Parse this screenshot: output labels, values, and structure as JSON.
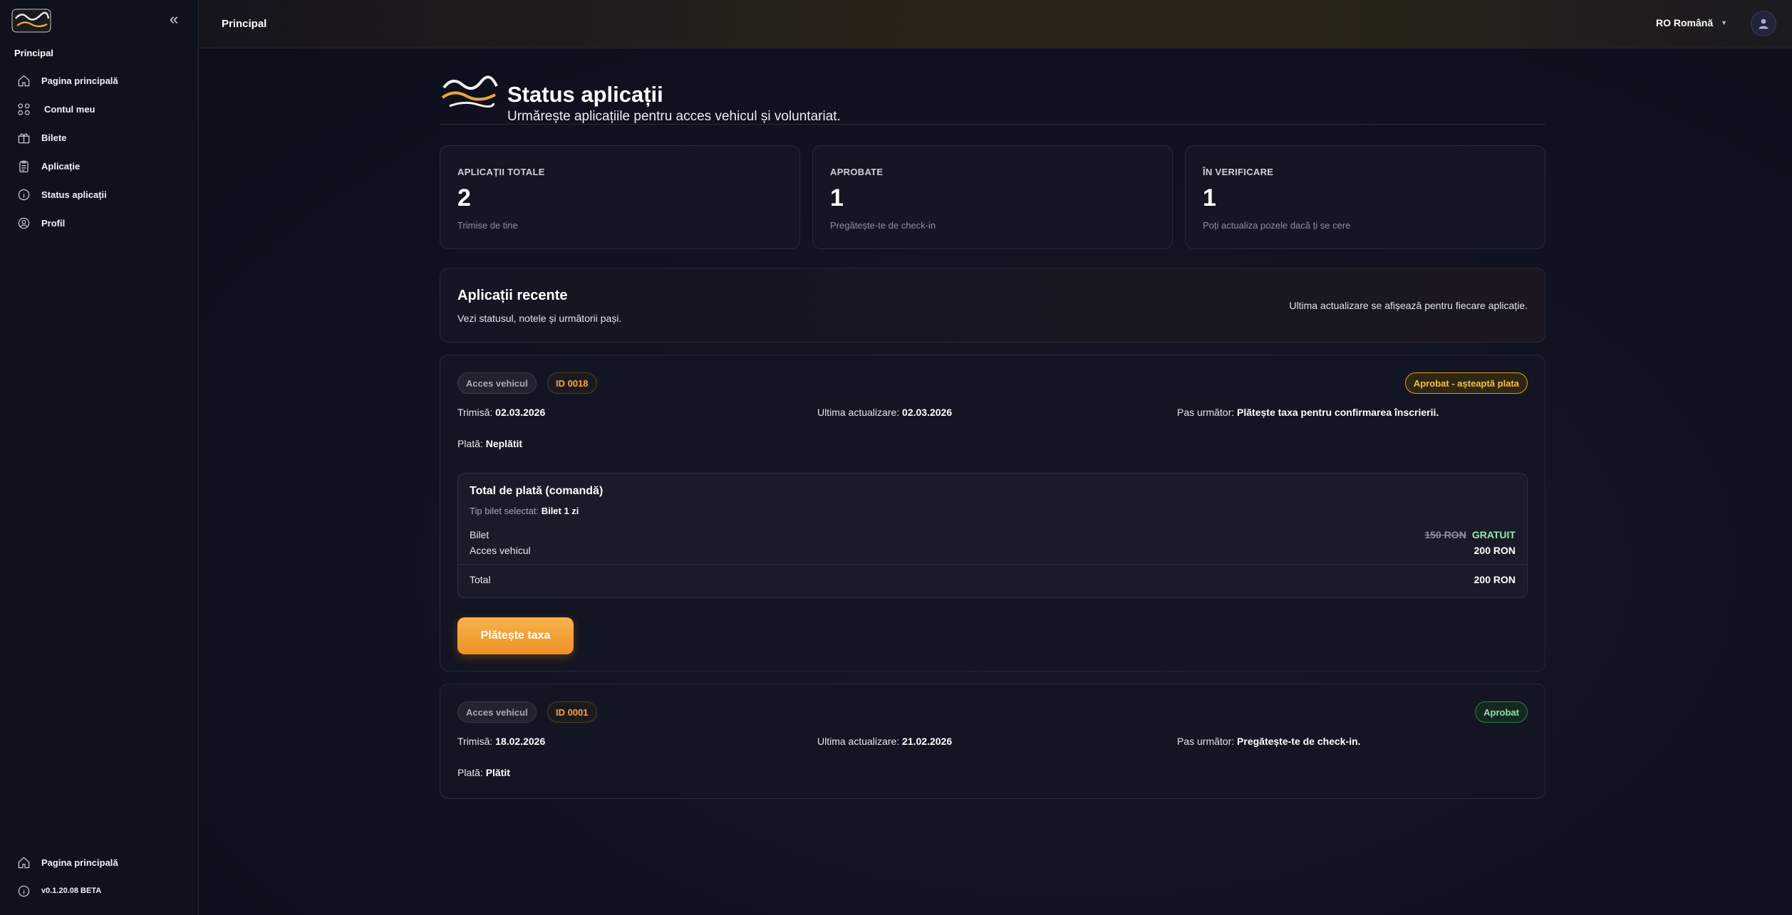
{
  "sidebar": {
    "section_label": "Principal",
    "items": [
      {
        "label": "Pagina principală",
        "icon": "home-icon"
      },
      {
        "label": "Contul meu",
        "icon": "grid-icon"
      },
      {
        "label": "Bilete",
        "icon": "gift-icon"
      },
      {
        "label": "Aplicație",
        "icon": "clipboard-icon"
      },
      {
        "label": "Status aplicații",
        "icon": "info-icon"
      },
      {
        "label": "Profil",
        "icon": "user-circle-icon"
      }
    ],
    "footer": {
      "home_label": "Pagina principală",
      "version": "v0.1.20.08 BETA"
    }
  },
  "header": {
    "title": "Principal",
    "language": "RO Română"
  },
  "page": {
    "title": "Status aplicații",
    "subtitle": "Urmărește aplicațiile pentru acces vehicul și voluntariat."
  },
  "stats": [
    {
      "label": "APLICAȚII TOTALE",
      "value": "2",
      "note": "Trimise de tine"
    },
    {
      "label": "APROBATE",
      "value": "1",
      "note": "Pregătește-te de check-in"
    },
    {
      "label": "ÎN VERIFICARE",
      "value": "1",
      "note": "Poți actualiza pozele dacă ți se cere"
    }
  ],
  "recent": {
    "title": "Aplicații recente",
    "subtitle": "Vezi statusul, notele și următorii pași.",
    "note": "Ultima actualizare se afișează pentru fiecare aplicație."
  },
  "applications": [
    {
      "type": "Acces vehicul",
      "id": "ID 0018",
      "status": "Aprobat - așteaptă plata",
      "submitted_label": "Trimisă:",
      "submitted": "02.03.2026",
      "updated_label": "Ultima actualizare:",
      "updated": "02.03.2026",
      "next_label": "Pas următor:",
      "next": "Plătește taxa pentru confirmarea înscrierii.",
      "payment_label": "Plată:",
      "payment": "Neplătit",
      "order": {
        "title": "Total de plată (comandă)",
        "ticket_label": "Tip bilet selectat:",
        "ticket": "Bilet 1 zi",
        "rows": [
          {
            "label": "Bilet",
            "old_price": "150 RON",
            "price": "GRATUIT"
          },
          {
            "label": "Acces vehicul",
            "price": "200 RON"
          }
        ],
        "total_label": "Total",
        "total": "200 RON"
      },
      "pay_button": "Plătește taxa"
    },
    {
      "type": "Acces vehicul",
      "id": "ID 0001",
      "status": "Aprobat",
      "submitted_label": "Trimisă:",
      "submitted": "18.02.2026",
      "updated_label": "Ultima actualizare:",
      "updated": "21.02.2026",
      "next_label": "Pas următor:",
      "next": "Pregătește-te de check-in.",
      "payment_label": "Plată:",
      "payment": "Plătit"
    }
  ],
  "colors": {
    "accent": "#F5A744",
    "success": "#8FE0AB",
    "background": "#0D0E1A"
  }
}
